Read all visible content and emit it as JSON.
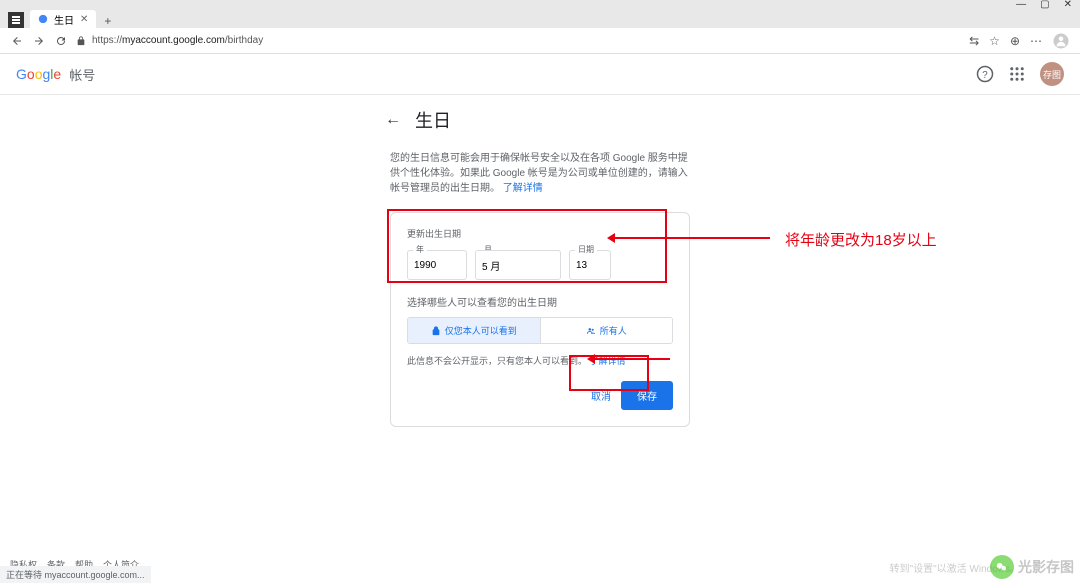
{
  "browser": {
    "window_controls": {
      "minimize": "—",
      "maximize": "▢",
      "close": "✕"
    },
    "tab": {
      "title": "生日",
      "close": "✕"
    },
    "new_tab": "+",
    "url": "https://myaccount.google.com/birthday",
    "url_prefix": "https://",
    "url_host": "myaccount.google.com",
    "url_path": "/birthday"
  },
  "header": {
    "logo": {
      "g": "G",
      "o1": "o",
      "o2": "o",
      "g2": "g",
      "l": "l",
      "e": "e"
    },
    "account_label": "帐号",
    "avatar_text": "存图"
  },
  "main": {
    "title": "生日",
    "description_1": "您的生日信息可能会用于确保帐号安全以及在各项 Google 服务中提供个性化体验。如果此 Google 帐号是为公司或单位创建的，请输入帐号管理员的出生日期。",
    "learn_more": "了解详情",
    "section_label": "更新出生日期",
    "year": {
      "label": "年",
      "value": "1990"
    },
    "month": {
      "label": "月",
      "value": "5 月"
    },
    "day": {
      "label": "日期",
      "value": "13"
    },
    "visibility_label": "选择哪些人可以查看您的出生日期",
    "visibility_options": {
      "only_you": "仅您本人可以看到",
      "everyone": "所有人"
    },
    "visibility_note_1": "此信息不会公开显示，只有您本人可以看到。",
    "visibility_learn": "了解详情",
    "cancel": "取消",
    "save": "保存"
  },
  "annotation": {
    "text": "将年龄更改为18岁以上"
  },
  "footer": {
    "links": [
      "隐私权",
      "条款",
      "帮助",
      "个人简介"
    ],
    "status": "正在等待 myaccount.google.com...",
    "watermark_settings": "转到\"设置\"以激活 Windows。",
    "wechat_text": "光影存图"
  }
}
